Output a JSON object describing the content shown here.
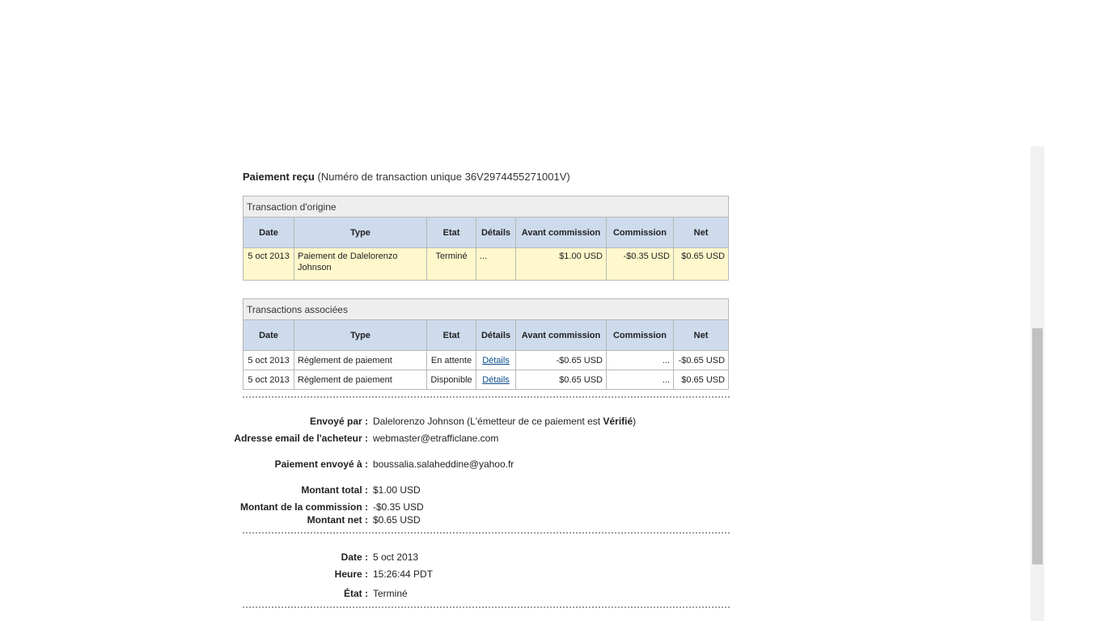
{
  "header": {
    "title_bold": "Paiement reçu",
    "title_rest": "(Numéro de transaction unique 36V2974455271001V)"
  },
  "columns": [
    "Date",
    "Type",
    "Etat",
    "Détails",
    "Avant commission",
    "Commission",
    "Net"
  ],
  "original": {
    "caption": "Transaction d'origine",
    "row": {
      "date": "5 oct 2013",
      "type": "Paiement de Dalelorenzo Johnson",
      "state": "Terminé",
      "details": "...",
      "gross": "$1.00 USD",
      "fee": "-$0.35 USD",
      "net": "$0.65 USD"
    }
  },
  "related": {
    "caption": "Transactions associées",
    "rows": [
      {
        "date": "5 oct 2013",
        "type": "Règlement de paiement",
        "state": "En attente",
        "details": "Détails",
        "gross": "-$0.65 USD",
        "fee": "...",
        "net": "-$0.65 USD"
      },
      {
        "date": "5 oct 2013",
        "type": "Règlement de paiement",
        "state": "Disponible",
        "details": "Détails",
        "gross": "$0.65 USD",
        "fee": "...",
        "net": "$0.65 USD"
      }
    ]
  },
  "details": {
    "sent_by_label": "Envoyé par :",
    "sent_by_name": "Dalelorenzo Johnson",
    "sent_by_note": "(L'émetteur de ce paiement est ",
    "sent_by_status": "Vérifié",
    "sent_by_close": ")",
    "buyer_email_label": "Adresse email de l'acheteur :",
    "buyer_email": "webmaster@etrafficlane.com",
    "sent_to_label": "Paiement envoyé à :",
    "sent_to": "boussalia.salaheddine@yahoo.fr",
    "total_label": "Montant total :",
    "total": "$1.00 USD",
    "fee_label": "Montant de la commission :",
    "fee": "-$0.35 USD",
    "net_label": "Montant net :",
    "net": "$0.65 USD",
    "date_label": "Date :",
    "date": "5 oct 2013",
    "time_label": "Heure :",
    "time": "15:26:44 PDT",
    "status_label": "État :",
    "status": "Terminé"
  }
}
